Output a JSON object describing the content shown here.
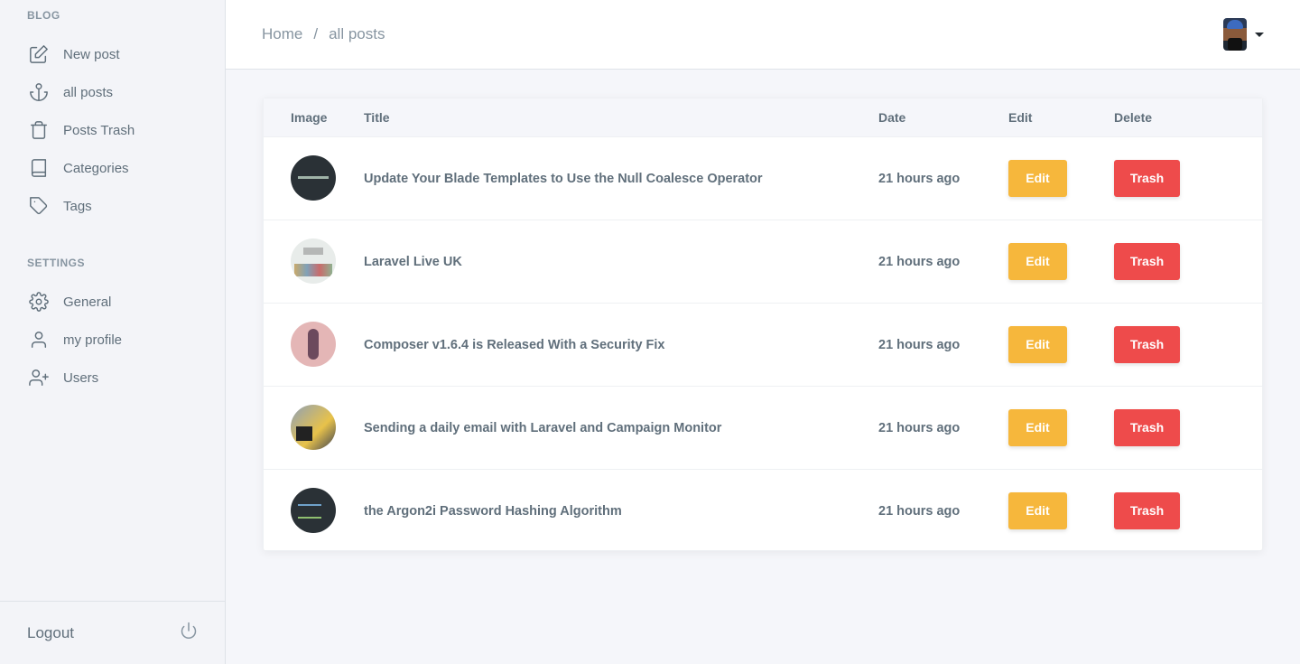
{
  "sidebar": {
    "blog_label": "BLOG",
    "settings_label": "SETTINGS",
    "blog_items": [
      {
        "label": "New post",
        "icon": "edit-icon"
      },
      {
        "label": "all posts",
        "icon": "anchor-icon"
      },
      {
        "label": "Posts Trash",
        "icon": "trash-icon"
      },
      {
        "label": "Categories",
        "icon": "book-icon"
      },
      {
        "label": "Tags",
        "icon": "tag-icon"
      }
    ],
    "settings_items": [
      {
        "label": "General",
        "icon": "gear-icon"
      },
      {
        "label": "my profile",
        "icon": "user-icon"
      },
      {
        "label": "Users",
        "icon": "user-plus-icon"
      }
    ],
    "logout_label": "Logout"
  },
  "header": {
    "breadcrumb": [
      "Home",
      "all posts"
    ],
    "breadcrumb_separator": "/"
  },
  "table": {
    "columns": [
      "Image",
      "Title",
      "Date",
      "Edit",
      "Delete"
    ],
    "rows": [
      {
        "title": "Update Your Blade Templates to Use the Null Coalesce Operator",
        "date": "21 hours ago",
        "edit_label": "Edit",
        "delete_label": "Trash"
      },
      {
        "title": "Laravel Live UK",
        "date": "21 hours ago",
        "edit_label": "Edit",
        "delete_label": "Trash"
      },
      {
        "title": "Composer v1.6.4 is Released With a Security Fix",
        "date": "21 hours ago",
        "edit_label": "Edit",
        "delete_label": "Trash"
      },
      {
        "title": "Sending a daily email with Laravel and Campaign Monitor",
        "date": "21 hours ago",
        "edit_label": "Edit",
        "delete_label": "Trash"
      },
      {
        "title": "the Argon2i Password Hashing Algorithm",
        "date": "21 hours ago",
        "edit_label": "Edit",
        "delete_label": "Trash"
      }
    ]
  },
  "colors": {
    "edit_button": "#f6b73c",
    "trash_button": "#ee4b4b",
    "sidebar_bg": "#f3f4f8",
    "text": "#606f7b"
  }
}
